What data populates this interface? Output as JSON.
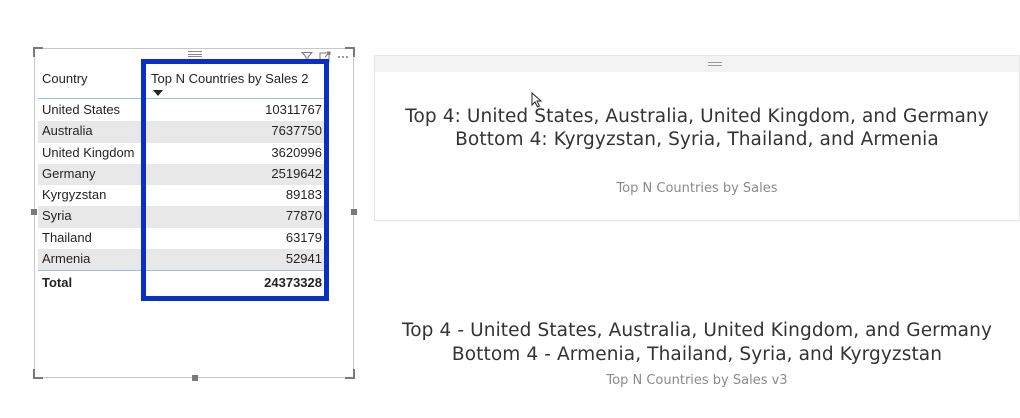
{
  "table": {
    "headers": {
      "country": "Country",
      "measure": "Top N Countries by Sales 2"
    },
    "rows": [
      {
        "country": "United States",
        "value": "10311767"
      },
      {
        "country": "Australia",
        "value": "7637750"
      },
      {
        "country": "United Kingdom",
        "value": "3620996"
      },
      {
        "country": "Germany",
        "value": "2519642"
      },
      {
        "country": "Kyrgyzstan",
        "value": "89183"
      },
      {
        "country": "Syria",
        "value": "77870"
      },
      {
        "country": "Thailand",
        "value": "63179"
      },
      {
        "country": "Armenia",
        "value": "52941"
      }
    ],
    "total": {
      "label": "Total",
      "value": "24373328"
    },
    "highlight_color": "#0a2fc7",
    "toolbar_icons": [
      "filter-icon",
      "focus-mode-icon",
      "more-options-icon"
    ]
  },
  "card1": {
    "line1": "Top 4: United States, Australia, United Kingdom, and Germany",
    "line2": "Bottom 4: Kyrgyzstan, Syria, Thailand, and Armenia",
    "caption": "Top N Countries by Sales"
  },
  "card2": {
    "line1": "Top 4 - United States, Australia, United Kingdom, and Germany",
    "line2": "Bottom 4 - Armenia, Thailand, Syria, and Kyrgyzstan",
    "caption": "Top N Countries by Sales v3"
  }
}
